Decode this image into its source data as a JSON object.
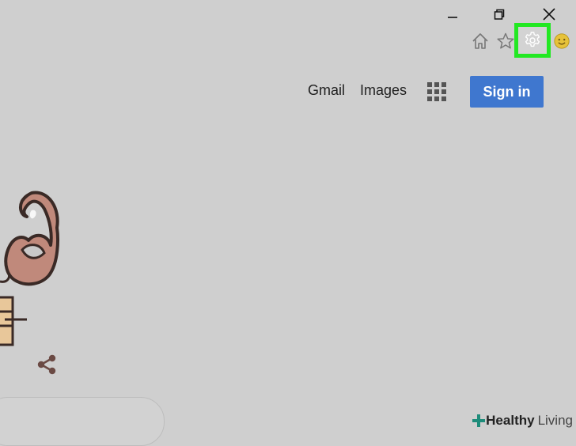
{
  "window_controls": {
    "minimize_icon": "minimize-icon",
    "restore_icon": "restore-icon",
    "close_icon": "close-icon"
  },
  "toolbar": {
    "icons": [
      "home-icon",
      "star-icon",
      "gear-icon",
      "smiley-icon"
    ],
    "highlight_color": "#22e822"
  },
  "header": {
    "gmail_label": "Gmail",
    "images_label": "Images",
    "apps_icon": "apps-grid-icon",
    "signin_label": "Sign in",
    "signin_color": "#3f77cf"
  },
  "doodle": {
    "share_icon": "share-icon"
  },
  "watermark": {
    "bold": "Healthy",
    "light": "Living"
  },
  "colors": {
    "background": "#cfcfcf"
  }
}
